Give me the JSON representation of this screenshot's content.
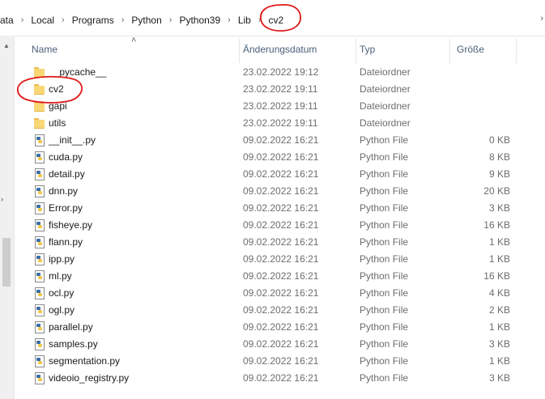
{
  "breadcrumb": [
    "ata",
    "Local",
    "Programs",
    "Python",
    "Python39",
    "Lib",
    "cv2"
  ],
  "header": {
    "name": "Name",
    "date": "Änderungsdatum",
    "type": "Typ",
    "size": "Größe"
  },
  "files": [
    {
      "name": "__pycache__",
      "date": "23.02.2022 19:12",
      "type": "Dateiordner",
      "size": "",
      "icon": "folder-icon"
    },
    {
      "name": "cv2",
      "date": "23.02.2022 19:11",
      "type": "Dateiordner",
      "size": "",
      "icon": "folder-icon"
    },
    {
      "name": "gapi",
      "date": "23.02.2022 19:11",
      "type": "Dateiordner",
      "size": "",
      "icon": "folder-icon"
    },
    {
      "name": "utils",
      "date": "23.02.2022 19:11",
      "type": "Dateiordner",
      "size": "",
      "icon": "folder-icon"
    },
    {
      "name": "__init__.py",
      "date": "09.02.2022 16:21",
      "type": "Python File",
      "size": "0 KB",
      "icon": "python-file-icon"
    },
    {
      "name": "cuda.py",
      "date": "09.02.2022 16:21",
      "type": "Python File",
      "size": "8 KB",
      "icon": "python-file-icon"
    },
    {
      "name": "detail.py",
      "date": "09.02.2022 16:21",
      "type": "Python File",
      "size": "9 KB",
      "icon": "python-file-icon"
    },
    {
      "name": "dnn.py",
      "date": "09.02.2022 16:21",
      "type": "Python File",
      "size": "20 KB",
      "icon": "python-file-icon"
    },
    {
      "name": "Error.py",
      "date": "09.02.2022 16:21",
      "type": "Python File",
      "size": "3 KB",
      "icon": "python-file-icon"
    },
    {
      "name": "fisheye.py",
      "date": "09.02.2022 16:21",
      "type": "Python File",
      "size": "16 KB",
      "icon": "python-file-icon"
    },
    {
      "name": "flann.py",
      "date": "09.02.2022 16:21",
      "type": "Python File",
      "size": "1 KB",
      "icon": "python-file-icon"
    },
    {
      "name": "ipp.py",
      "date": "09.02.2022 16:21",
      "type": "Python File",
      "size": "1 KB",
      "icon": "python-file-icon"
    },
    {
      "name": "ml.py",
      "date": "09.02.2022 16:21",
      "type": "Python File",
      "size": "16 KB",
      "icon": "python-file-icon"
    },
    {
      "name": "ocl.py",
      "date": "09.02.2022 16:21",
      "type": "Python File",
      "size": "4 KB",
      "icon": "python-file-icon"
    },
    {
      "name": "ogl.py",
      "date": "09.02.2022 16:21",
      "type": "Python File",
      "size": "2 KB",
      "icon": "python-file-icon"
    },
    {
      "name": "parallel.py",
      "date": "09.02.2022 16:21",
      "type": "Python File",
      "size": "1 KB",
      "icon": "python-file-icon"
    },
    {
      "name": "samples.py",
      "date": "09.02.2022 16:21",
      "type": "Python File",
      "size": "3 KB",
      "icon": "python-file-icon"
    },
    {
      "name": "segmentation.py",
      "date": "09.02.2022 16:21",
      "type": "Python File",
      "size": "1 KB",
      "icon": "python-file-icon"
    },
    {
      "name": "videoio_registry.py",
      "date": "09.02.2022 16:21",
      "type": "Python File",
      "size": "3 KB",
      "icon": "python-file-icon"
    }
  ],
  "colors": {
    "annotation": "#e01818",
    "folder": "#f8d775",
    "header_text": "#4c607a",
    "meta_text": "#6d6d6d"
  }
}
